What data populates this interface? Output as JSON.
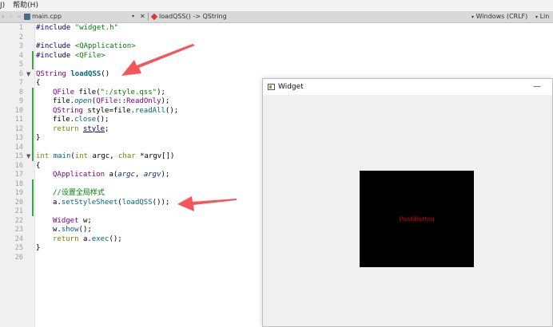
{
  "menubar": {
    "items": [
      "J)",
      "帮助(H)"
    ]
  },
  "tabbar": {
    "file_name": "main.cpp",
    "function_label": "loadQSS() -> QString",
    "encoding_label": "Windows (CRLF)",
    "extra_label": "Lin"
  },
  "editor": {
    "line_numbers": [
      "1",
      "2",
      "3",
      "4",
      "5",
      "6",
      "7",
      "8",
      "9",
      "10",
      "11",
      "12",
      "13",
      "14",
      "15",
      "16",
      "17",
      "18",
      "19",
      "20",
      "21",
      "22",
      "23",
      "24",
      "25",
      "26"
    ],
    "lines": {
      "l1": {
        "pp": "#include ",
        "str": "\"widget.h\""
      },
      "l3": {
        "pp": "#include ",
        "str": "<QApplication>"
      },
      "l4": {
        "pp": "#include ",
        "str": "<QFile>"
      },
      "l6": {
        "type": "QString ",
        "fn": "loadQSS",
        "rest": "()"
      },
      "l7": "{",
      "l8": {
        "type": "QFile ",
        "a": "file(",
        "str": "\":/style.qss\"",
        "b": ");"
      },
      "l9": {
        "a": "file.",
        "fn": "open",
        "b": "(",
        "ty": "QFile",
        "c": "::",
        "en": "ReadOnly",
        "d": ");"
      },
      "l10": {
        "type": "QString ",
        "a": "style=file.",
        "fn": "readAll",
        "b": "();"
      },
      "l11": {
        "a": "file.",
        "fn": "close",
        "b": "();"
      },
      "l12": {
        "kw": "return ",
        "link": "style",
        "b": ";"
      },
      "l13": "}",
      "l15": {
        "kw1": "int ",
        "fn": "main",
        "a": "(",
        "kw2": "int ",
        "b": "argc, ",
        "kw3": "char ",
        "c": "*argv[])"
      },
      "l16": "{",
      "l17": {
        "type": "QApplication ",
        "a": "a(",
        "it1": "argc",
        "b": ", ",
        "it2": "argv",
        "c": ");"
      },
      "l19": "//设置全局样式",
      "l20": {
        "a": "a.",
        "fn": "setStyleSheet",
        "b": "(",
        "fn2": "loadQSS",
        "c": "());"
      },
      "l22": {
        "type": "Widget ",
        "a": "w;"
      },
      "l23": {
        "a": "w.",
        "fn": "show",
        "b": "();"
      },
      "l24": {
        "kw": "return ",
        "a": "a.",
        "fn": "exec",
        "b": "();"
      },
      "l25": "}"
    }
  },
  "widget_window": {
    "title": "Widget",
    "minimize_glyph": "—",
    "push_button_label": "PushButton",
    "push_button_text_color": "#e00000"
  },
  "colors": {
    "arrow": "#f4565a",
    "change_bar": "#3ea04a",
    "keyword": "#808000",
    "string": "#008000",
    "function": "#00677c"
  },
  "icons": {
    "file": "cpp-file-icon",
    "function": "function-icon",
    "window": "window-app-icon",
    "annotation": "red-arrow-icon"
  }
}
